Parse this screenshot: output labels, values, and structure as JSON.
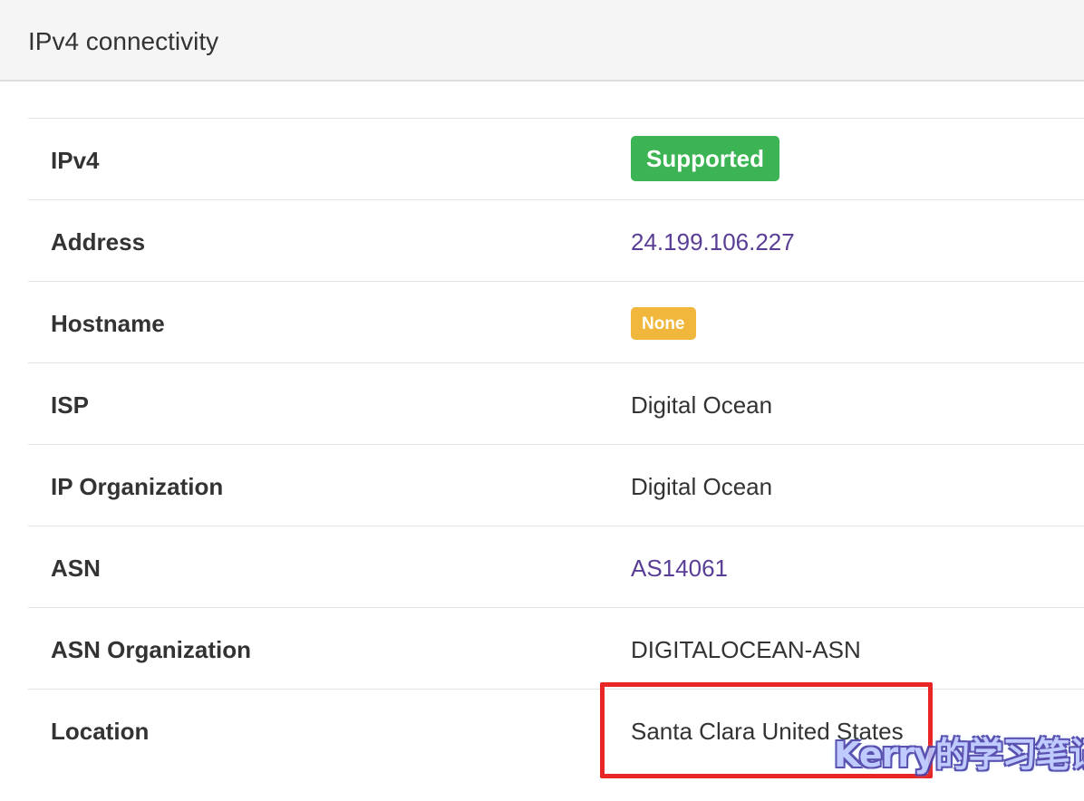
{
  "panel": {
    "title": "IPv4 connectivity"
  },
  "rows": {
    "ipv4": {
      "label": "IPv4",
      "value": "Supported"
    },
    "address": {
      "label": "Address",
      "value": "24.199.106.227"
    },
    "hostname": {
      "label": "Hostname",
      "value": "None"
    },
    "isp": {
      "label": "ISP",
      "value": "Digital Ocean"
    },
    "ip_org": {
      "label": "IP Organization",
      "value": "Digital Ocean"
    },
    "asn": {
      "label": "ASN",
      "value": "AS14061"
    },
    "asn_org": {
      "label": "ASN Organization",
      "value": "DIGITALOCEAN-ASN"
    },
    "location": {
      "label": "Location",
      "value": "Santa Clara United States"
    }
  },
  "watermark": "Kerry的学习笔记",
  "colors": {
    "supported_badge": "#3cb454",
    "none_badge": "#f0b73c",
    "link": "#5a3e96",
    "highlight_box": "#e82626"
  }
}
